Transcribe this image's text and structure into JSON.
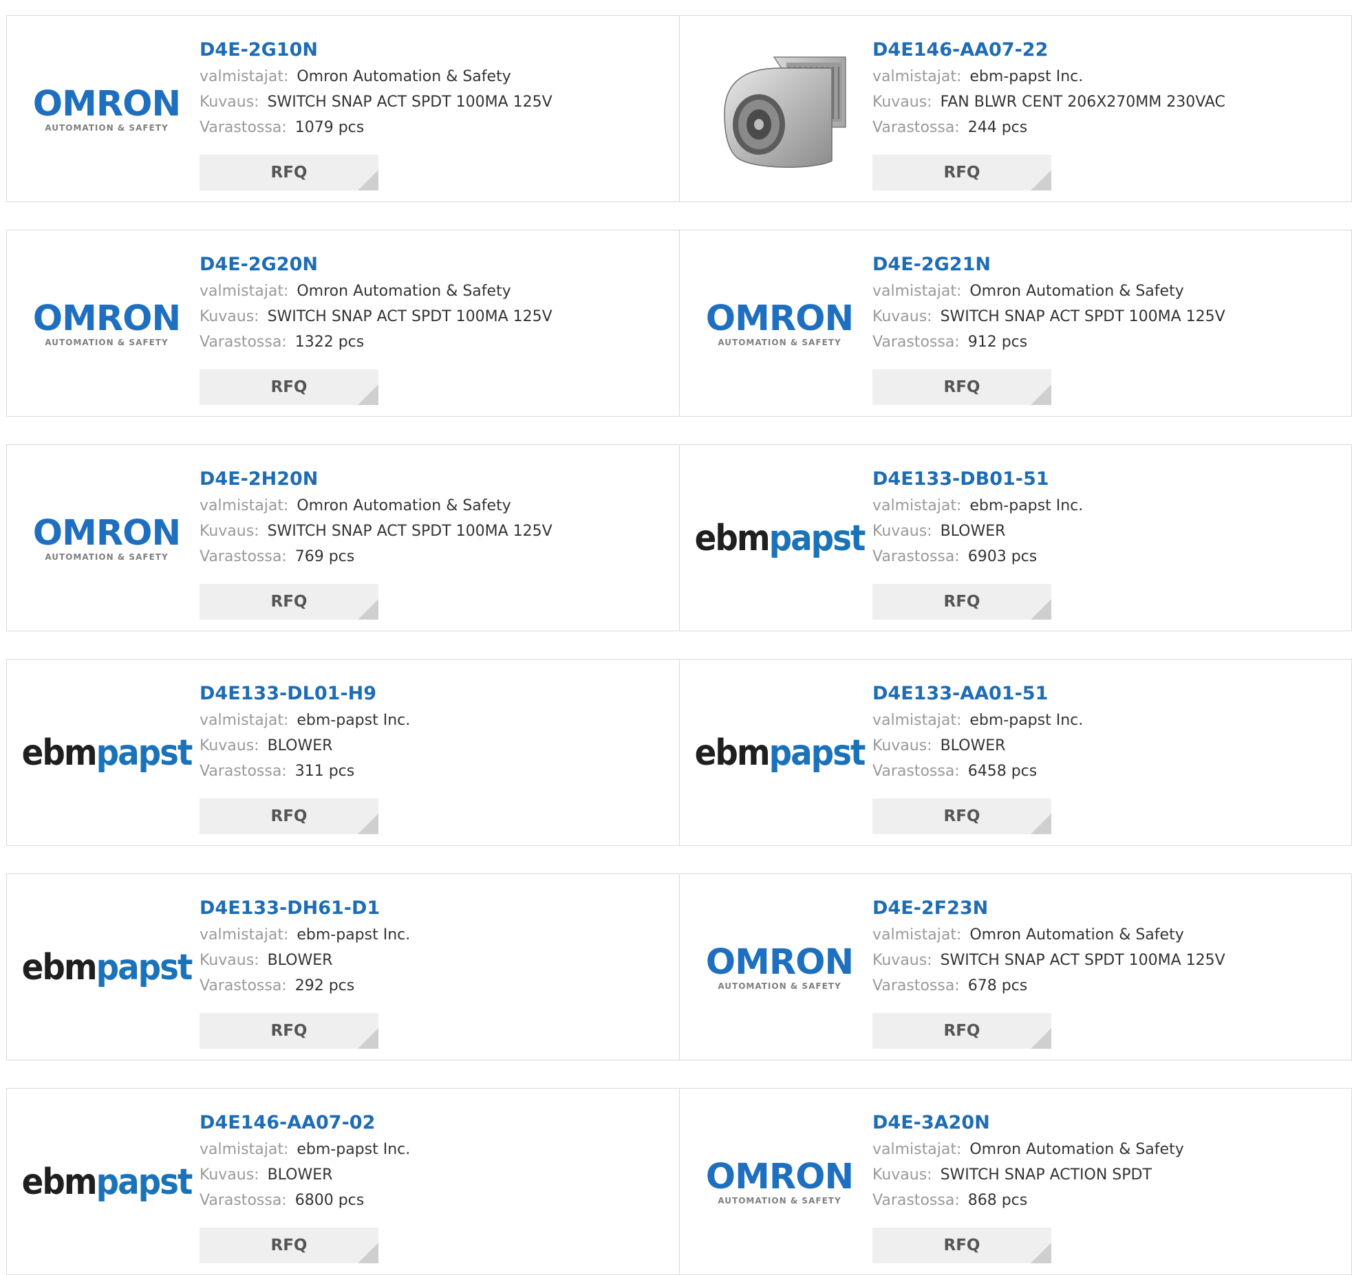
{
  "labels": {
    "manufacturer": "valmistajat:",
    "description": "Kuvaus:",
    "stock": "Varastossa:",
    "rfq": "RFQ"
  },
  "logos": {
    "omron": {
      "word": "OMRON",
      "sub": "AUTOMATION & SAFETY"
    },
    "ebmpapst": {
      "part1": "ebm",
      "part2": "papst"
    }
  },
  "colors": {
    "link": "#1d6cb5",
    "omron_blue": "#1e6fbf",
    "ebm_blue": "#1a72b9",
    "border": "#d9d9d9",
    "rfq_bg": "#efefef"
  },
  "products": [
    {
      "part": "D4E-2G10N",
      "logo": "omron",
      "manufacturer": "Omron Automation & Safety",
      "description": "SWITCH SNAP ACT SPDT 100MA 125V",
      "stock": "1079 pcs"
    },
    {
      "part": "D4E146-AA07-22",
      "logo": "blower-photo",
      "manufacturer": "ebm-papst Inc.",
      "description": "FAN BLWR CENT 206X270MM 230VAC",
      "stock": "244 pcs"
    },
    {
      "part": "D4E-2G20N",
      "logo": "omron",
      "manufacturer": "Omron Automation & Safety",
      "description": "SWITCH SNAP ACT SPDT 100MA 125V",
      "stock": "1322 pcs"
    },
    {
      "part": "D4E-2G21N",
      "logo": "omron",
      "manufacturer": "Omron Automation & Safety",
      "description": "SWITCH SNAP ACT SPDT 100MA 125V",
      "stock": "912 pcs"
    },
    {
      "part": "D4E-2H20N",
      "logo": "omron",
      "manufacturer": "Omron Automation & Safety",
      "description": "SWITCH SNAP ACT SPDT 100MA 125V",
      "stock": "769 pcs"
    },
    {
      "part": "D4E133-DB01-51",
      "logo": "ebmpapst",
      "manufacturer": "ebm-papst Inc.",
      "description": "BLOWER",
      "stock": "6903 pcs"
    },
    {
      "part": "D4E133-DL01-H9",
      "logo": "ebmpapst",
      "manufacturer": "ebm-papst Inc.",
      "description": "BLOWER",
      "stock": "311 pcs"
    },
    {
      "part": "D4E133-AA01-51",
      "logo": "ebmpapst",
      "manufacturer": "ebm-papst Inc.",
      "description": "BLOWER",
      "stock": "6458 pcs"
    },
    {
      "part": "D4E133-DH61-D1",
      "logo": "ebmpapst",
      "manufacturer": "ebm-papst Inc.",
      "description": "BLOWER",
      "stock": "292 pcs"
    },
    {
      "part": "D4E-2F23N",
      "logo": "omron",
      "manufacturer": "Omron Automation & Safety",
      "description": "SWITCH SNAP ACT SPDT 100MA 125V",
      "stock": "678 pcs"
    },
    {
      "part": "D4E146-AA07-02",
      "logo": "ebmpapst",
      "manufacturer": "ebm-papst Inc.",
      "description": "BLOWER",
      "stock": "6800 pcs"
    },
    {
      "part": "D4E-3A20N",
      "logo": "omron",
      "manufacturer": "Omron Automation & Safety",
      "description": "SWITCH SNAP ACTION SPDT",
      "stock": "868 pcs"
    }
  ]
}
